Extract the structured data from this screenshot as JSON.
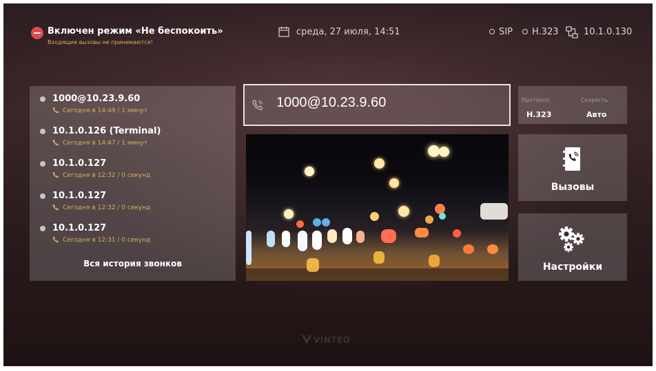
{
  "status_bar": {
    "dnd_title": "Включен режим «Не беспокоить»",
    "dnd_subtitle": "Входящие вызовы не принимаются!",
    "datetime": "среда, 27 июля, 14:51",
    "sip_label": "SIP",
    "h323_label": "H.323",
    "ip_address": "10.1.0.130"
  },
  "history": {
    "items": [
      {
        "name": "1000@10.23.9.60",
        "detail": "Сегодня в 14:49 / 1 минут"
      },
      {
        "name": "10.1.0.126 (Terminal)",
        "detail": "Сегодня в 14:47 / 1 минут"
      },
      {
        "name": "10.1.0.127",
        "detail": "Сегодня в 12:32 / 0 секунд"
      },
      {
        "name": "10.1.0.127",
        "detail": "Сегодня в 12:32 / 0 секунд"
      },
      {
        "name": "10.1.0.127",
        "detail": "Сегодня в 12:31 / 0 секунд"
      }
    ],
    "all_history_label": "Вся история звонков"
  },
  "dial": {
    "value": "1000@10.23.9.60"
  },
  "protocol_panel": {
    "protocol_label": "Протокол",
    "protocol_value": "H.323",
    "speed_label": "Скорость",
    "speed_value": "Авто"
  },
  "tiles": {
    "calls_label": "Вызовы",
    "settings_label": "Настройки"
  },
  "logo_text": "VINTEO",
  "colors": {
    "accent_gold": "#d6b05a",
    "dnd_red": "#e0484b",
    "panel": "rgba(255,255,255,0.18)"
  }
}
